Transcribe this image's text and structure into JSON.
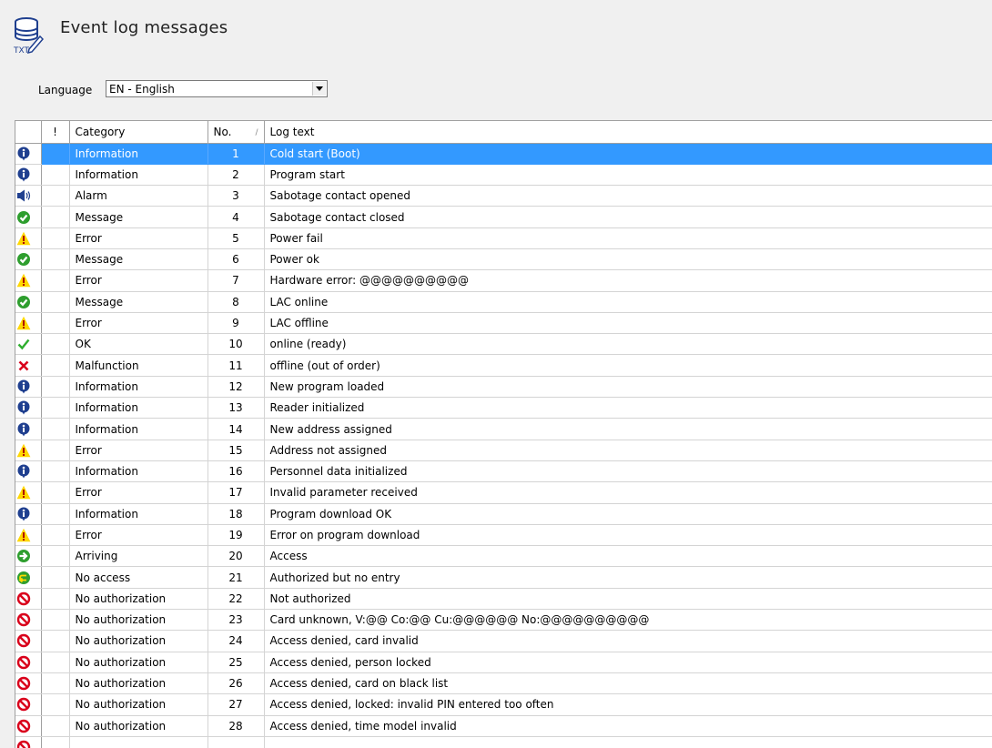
{
  "page": {
    "title": "Event log messages",
    "title_icon": "database-txt-icon"
  },
  "language": {
    "label": "Language",
    "value": "EN - English"
  },
  "table": {
    "columns": [
      "",
      "!",
      "Category",
      "No.",
      "Log text"
    ],
    "sort_indicator": "/",
    "selected_row": 0,
    "rows": [
      {
        "icon": "info",
        "category": "Information",
        "no": "1",
        "text": "Cold start (Boot)"
      },
      {
        "icon": "info",
        "category": "Information",
        "no": "2",
        "text": "Program start"
      },
      {
        "icon": "alarm",
        "category": "Alarm",
        "no": "3",
        "text": "Sabotage contact opened"
      },
      {
        "icon": "message",
        "category": "Message",
        "no": "4",
        "text": "Sabotage contact closed"
      },
      {
        "icon": "error",
        "category": "Error",
        "no": "5",
        "text": "Power fail"
      },
      {
        "icon": "message",
        "category": "Message",
        "no": "6",
        "text": "Power ok"
      },
      {
        "icon": "error",
        "category": "Error",
        "no": "7",
        "text": "Hardware error: @@@@@@@@@@"
      },
      {
        "icon": "message",
        "category": "Message",
        "no": "8",
        "text": "LAC online"
      },
      {
        "icon": "error",
        "category": "Error",
        "no": "9",
        "text": "LAC offline"
      },
      {
        "icon": "ok",
        "category": "OK",
        "no": "10",
        "text": "online (ready)"
      },
      {
        "icon": "malfunction",
        "category": "Malfunction",
        "no": "11",
        "text": "offline (out of order)"
      },
      {
        "icon": "info",
        "category": "Information",
        "no": "12",
        "text": "New program loaded"
      },
      {
        "icon": "info",
        "category": "Information",
        "no": "13",
        "text": "Reader initialized"
      },
      {
        "icon": "info",
        "category": "Information",
        "no": "14",
        "text": "New address assigned"
      },
      {
        "icon": "error",
        "category": "Error",
        "no": "15",
        "text": "Address not assigned"
      },
      {
        "icon": "info",
        "category": "Information",
        "no": "16",
        "text": "Personnel data initialized"
      },
      {
        "icon": "error",
        "category": "Error",
        "no": "17",
        "text": "Invalid parameter received"
      },
      {
        "icon": "info",
        "category": "Information",
        "no": "18",
        "text": "Program download OK"
      },
      {
        "icon": "error",
        "category": "Error",
        "no": "19",
        "text": "Error on program download"
      },
      {
        "icon": "arriving",
        "category": "Arriving",
        "no": "20",
        "text": "Access"
      },
      {
        "icon": "noaccess",
        "category": "No access",
        "no": "21",
        "text": "Authorized but no entry"
      },
      {
        "icon": "denied",
        "category": "No authorization",
        "no": "22",
        "text": "Not authorized"
      },
      {
        "icon": "denied",
        "category": "No authorization",
        "no": "23",
        "text": "Card unknown, V:@@ Co:@@ Cu:@@@@@@ No:@@@@@@@@@@"
      },
      {
        "icon": "denied",
        "category": "No authorization",
        "no": "24",
        "text": "Access denied, card invalid"
      },
      {
        "icon": "denied",
        "category": "No authorization",
        "no": "25",
        "text": "Access denied, person locked"
      },
      {
        "icon": "denied",
        "category": "No authorization",
        "no": "26",
        "text": "Access denied, card on black list"
      },
      {
        "icon": "denied",
        "category": "No authorization",
        "no": "27",
        "text": "Access denied, locked: invalid PIN entered too often"
      },
      {
        "icon": "denied",
        "category": "No authorization",
        "no": "28",
        "text": "Access denied, time model invalid"
      },
      {
        "icon": "denied",
        "category": "",
        "no": "",
        "text": ""
      }
    ]
  },
  "colors": {
    "selection": "#3399ff",
    "info": "#1f3f8f",
    "message": "#2e9e2e",
    "error": "#ffd800",
    "denied": "#d9001b"
  }
}
